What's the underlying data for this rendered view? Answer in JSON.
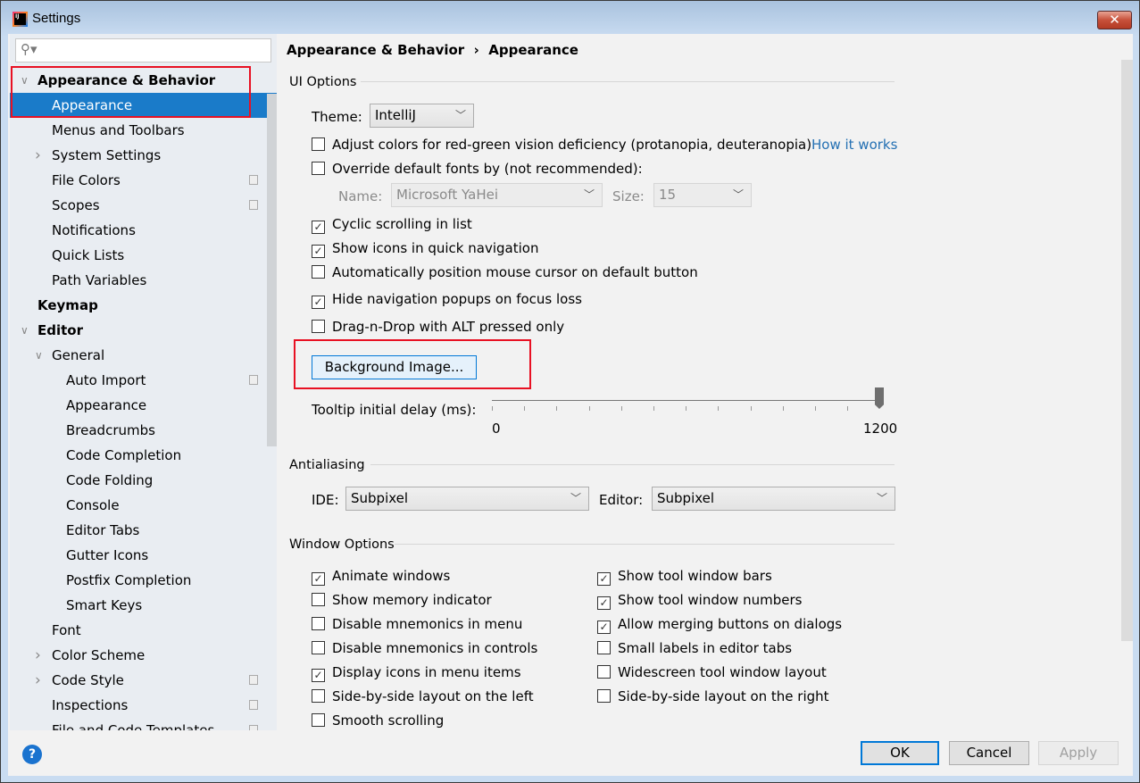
{
  "window": {
    "title": "Settings",
    "close": "✕"
  },
  "search": {
    "placeholder": "",
    "icon": "search-icon"
  },
  "tree": [
    {
      "label": "Appearance & Behavior",
      "level": 0,
      "expanded": true,
      "bold": true
    },
    {
      "label": "Appearance",
      "level": 1,
      "selected": true
    },
    {
      "label": "Menus and Toolbars",
      "level": 1
    },
    {
      "label": "System Settings",
      "level": 1,
      "expandable": true
    },
    {
      "label": "File Colors",
      "level": 1,
      "copy": true
    },
    {
      "label": "Scopes",
      "level": 1,
      "copy": true
    },
    {
      "label": "Notifications",
      "level": 1
    },
    {
      "label": "Quick Lists",
      "level": 1
    },
    {
      "label": "Path Variables",
      "level": 1
    },
    {
      "label": "Keymap",
      "level": 0,
      "bold": true
    },
    {
      "label": "Editor",
      "level": 0,
      "expanded": true,
      "bold": true
    },
    {
      "label": "General",
      "level": 1,
      "expanded": true
    },
    {
      "label": "Auto Import",
      "level": 2,
      "copy": true
    },
    {
      "label": "Appearance",
      "level": 2
    },
    {
      "label": "Breadcrumbs",
      "level": 2
    },
    {
      "label": "Code Completion",
      "level": 2
    },
    {
      "label": "Code Folding",
      "level": 2
    },
    {
      "label": "Console",
      "level": 2
    },
    {
      "label": "Editor Tabs",
      "level": 2
    },
    {
      "label": "Gutter Icons",
      "level": 2
    },
    {
      "label": "Postfix Completion",
      "level": 2
    },
    {
      "label": "Smart Keys",
      "level": 2
    },
    {
      "label": "Font",
      "level": 1
    },
    {
      "label": "Color Scheme",
      "level": 1,
      "expandable": true
    },
    {
      "label": "Code Style",
      "level": 1,
      "expandable": true,
      "copy": true
    },
    {
      "label": "Inspections",
      "level": 1,
      "copy": true
    },
    {
      "label": "File and Code Templates",
      "level": 1,
      "copy": true
    }
  ],
  "breadcrumb": {
    "parent": "Appearance & Behavior",
    "sep": "›",
    "current": "Appearance"
  },
  "ui_options": {
    "title": "UI Options",
    "theme_label": "Theme:",
    "theme_value": "IntelliJ",
    "protanopia": {
      "label": "Adjust colors for red-green vision deficiency (protanopia, deuteranopia)",
      "checked": false
    },
    "how_it_works": "How it works",
    "override_fonts": {
      "label": "Override default fonts by (not recommended):",
      "checked": false
    },
    "name_label": "Name:",
    "name_value": "Microsoft YaHei",
    "size_label": "Size:",
    "size_value": "15",
    "checks": [
      {
        "label": "Cyclic scrolling in list",
        "checked": true
      },
      {
        "label": "Show icons in quick navigation",
        "checked": true
      },
      {
        "label": "Automatically position mouse cursor on default button",
        "checked": false
      },
      {
        "label": "Hide navigation popups on focus loss",
        "checked": true
      },
      {
        "label": "Drag-n-Drop with ALT pressed only",
        "checked": false
      }
    ],
    "background_image": "Background Image...",
    "tooltip_label": "Tooltip initial delay (ms):",
    "tooltip_min": "0",
    "tooltip_max": "1200",
    "tooltip_value": 1200
  },
  "antialiasing": {
    "title": "Antialiasing",
    "ide_label": "IDE:",
    "ide_value": "Subpixel",
    "editor_label": "Editor:",
    "editor_value": "Subpixel"
  },
  "window_options": {
    "title": "Window Options",
    "left": [
      {
        "label": "Animate windows",
        "checked": true
      },
      {
        "label": "Show memory indicator",
        "checked": false
      },
      {
        "label": "Disable mnemonics in menu",
        "checked": false
      },
      {
        "label": "Disable mnemonics in controls",
        "checked": false
      },
      {
        "label": "Display icons in menu items",
        "checked": true
      },
      {
        "label": "Side-by-side layout on the left",
        "checked": false
      },
      {
        "label": "Smooth scrolling",
        "checked": false
      }
    ],
    "right": [
      {
        "label": "Show tool window bars",
        "checked": true
      },
      {
        "label": "Show tool window numbers",
        "checked": true
      },
      {
        "label": "Allow merging buttons on dialogs",
        "checked": true
      },
      {
        "label": "Small labels in editor tabs",
        "checked": false
      },
      {
        "label": "Widescreen tool window layout",
        "checked": false
      },
      {
        "label": "Side-by-side layout on the right",
        "checked": false
      }
    ]
  },
  "footer": {
    "help": "?",
    "ok": "OK",
    "cancel": "Cancel",
    "apply": "Apply"
  },
  "colors": {
    "selection": "#1a7bc9",
    "highlight": "#e81123",
    "link": "#2470b3"
  }
}
